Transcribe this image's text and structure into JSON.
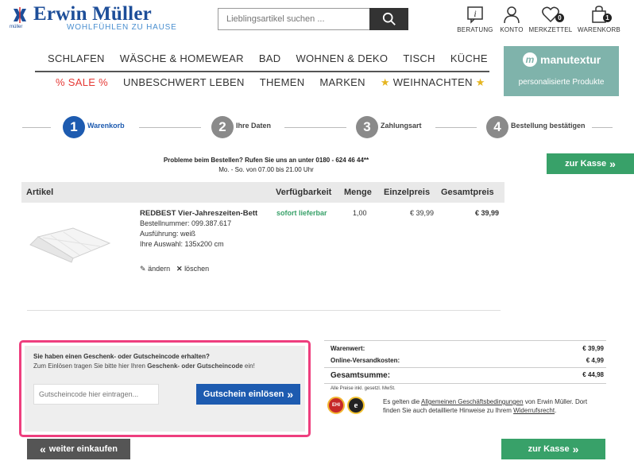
{
  "brand": {
    "name": "Erwin Müller",
    "tagline": "WOHLFÜHLEN ZU HAUSE",
    "logo_small": "müller",
    "accent": "#1d4e99"
  },
  "search": {
    "placeholder": "Lieblingsartikel suchen ..."
  },
  "header_icons": [
    {
      "icon": "info-icon",
      "label": "BERATUNG"
    },
    {
      "icon": "user-icon",
      "label": "KONTO"
    },
    {
      "icon": "heart-icon",
      "label": "MERKZETTEL",
      "badge": "0"
    },
    {
      "icon": "bag-icon",
      "label": "WARENKORB",
      "badge": "1"
    }
  ],
  "nav_primary": [
    "SCHLAFEN",
    "WÄSCHE & HOMEWEAR",
    "BAD",
    "WOHNEN & DEKO",
    "TISCH",
    "KÜCHE"
  ],
  "nav_secondary": [
    "% SALE %",
    "UNBESCHWERT LEBEN",
    "THEMEN",
    "MARKEN",
    "WEIHNACHTEN"
  ],
  "manutextur": {
    "title": "manutextur",
    "subtitle": "personalisierte Produkte",
    "color": "#7fb3ab"
  },
  "steps": [
    {
      "num": "1",
      "label": "Warenkorb",
      "active": true
    },
    {
      "num": "2",
      "label": "Ihre Daten"
    },
    {
      "num": "3",
      "label": "Zahlungsart"
    },
    {
      "num": "4",
      "label": "Bestellung bestätigen"
    }
  ],
  "checkout_label": "zur Kasse",
  "problem_line1": "Probleme beim Bestellen? Rufen Sie uns an unter 0180 - 624 46 44**",
  "problem_line2": "Mo. - So. von 07.00 bis 21.00 Uhr",
  "table": {
    "headers": [
      "Artikel",
      "Verfügbarkeit",
      "Menge",
      "Einzelpreis",
      "Gesamtpreis"
    ],
    "item": {
      "name": "REDBEST Vier-Jahreszeiten-Bett",
      "order_no": "Bestellnummer: 099.387.617",
      "variant": "Ausführung: weiß",
      "choice": "Ihre Auswahl: 135x200 cm",
      "availability": "sofort lieferbar",
      "quantity": "1,00",
      "unit_price": "€ 39,99",
      "total_price": "€ 39,99",
      "edit_label": "ändern",
      "delete_label": "löschen"
    }
  },
  "voucher": {
    "title": "Sie haben einen Geschenk- oder Gutscheincode erhalten?",
    "hint_pre": "Zum Einlösen tragen Sie bitte hier Ihren ",
    "hint_bold": "Geschenk- oder Gutscheincode",
    "hint_post": " ein!",
    "placeholder": "Gutscheincode hier eintragen...",
    "button": "Gutschein einlösen"
  },
  "summary": {
    "rows": [
      {
        "label": "Warenwert:",
        "value": "€ 39,99"
      },
      {
        "label": "Online-Versandkosten:",
        "value": "€ 4,99"
      }
    ],
    "total_label": "Gesamtsumme:",
    "total_value": "€ 44,98",
    "vat_note": "Alle Preise inkl. gesetzl. MwSt.",
    "terms_pre": "Es gelten die ",
    "terms_link": "Allgemeinen Geschäftsbedingungen",
    "terms_mid": " von Erwin Müller. Dort finden Sie auch detaillierte Hinweise zu Ihrem ",
    "terms_link2": "Widerrufsrecht",
    "terms_post": "."
  },
  "continue_label": "weiter einkaufen",
  "colors": {
    "green": "#38a169",
    "sale": "#e53935",
    "voucher_border": "#ee3e7e",
    "blue_button": "#1d5bb0"
  }
}
